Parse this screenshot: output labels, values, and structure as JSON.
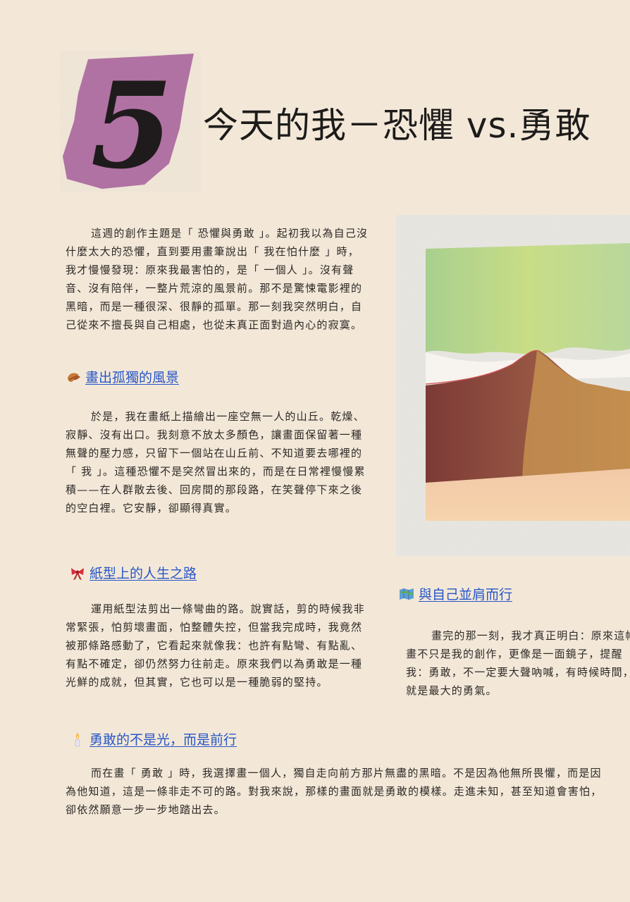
{
  "chapter_number": "5",
  "title": "今天的我－恐懼 vs.勇敢",
  "intro": "這週的創作主題是「 恐懼與勇敢 」。起初我以為自己沒什麼太大的恐懼，直到要用畫筆說出「 我在怕什麼 」時，我才慢慢發現：原來我最害怕的，是「 一個人 」。沒有聲音、沒有陪伴，一整片荒涼的風景前。那不是驚悚電影裡的黑暗，而是一種很深、很靜的孤單。那一刻我突然明白，自己從來不擅長與自己相處，也從未真正面對過內心的寂寞。",
  "sections": [
    {
      "icon": "leaf-icon",
      "heading": "畫出孤獨的風景",
      "body": "於是，我在畫紙上描繪出一座空無一人的山丘。乾燥、寂靜、沒有出口。我刻意不放太多顏色，讓畫面保留著一種無聲的壓力感，只留下一個站在山丘前、不知道要去哪裡的「 我 」。這種恐懼不是突然冒出來的，而是在日常裡慢慢累積——在人群散去後、回房間的那段路，在笑聲停下來之後的空白裡。它安靜，卻顯得真實。"
    },
    {
      "icon": "ribbon-icon",
      "heading": "紙型上的人生之路",
      "body": "運用紙型法剪出一條彎曲的路。說實話，剪的時候我非常緊張，怕剪壞畫面，怕整體失控，但當我完成時，我竟然被那條路感動了，它看起來就像我：也許有點彎、有點亂、有點不確定，卻仍然努力往前走。原來我們以為勇敢是一種光鮮的成就，但其實，它也可以是一種脆弱的堅持。"
    },
    {
      "icon": "map-icon",
      "heading": "與自己並肩而行",
      "body": "畫完的那一刻，我才真正明白：原來這幅畫不只是我的創作，更像是一面鏡子，提醒我：勇敢，不一定要大聲吶喊，有時候時間，就是最大的勇氣。"
    },
    {
      "icon": "candle-icon",
      "heading": "勇敢的不是光，而是前行",
      "body": "而在畫「 勇敢 」時，我選擇畫一個人，獨自走向前方那片無盡的黑暗。不是因為他無所畏懼，而是因為他知道，這是一條非走不可的路。對我來說，那樣的畫面就是勇敢的模樣。走進未知，甚至知道會害怕，卻依然願意一步一步地踏出去。"
    }
  ],
  "colors": {
    "page_background": "#f3e8d8",
    "number_badge": "#b374a6",
    "link": "#2756c8"
  }
}
